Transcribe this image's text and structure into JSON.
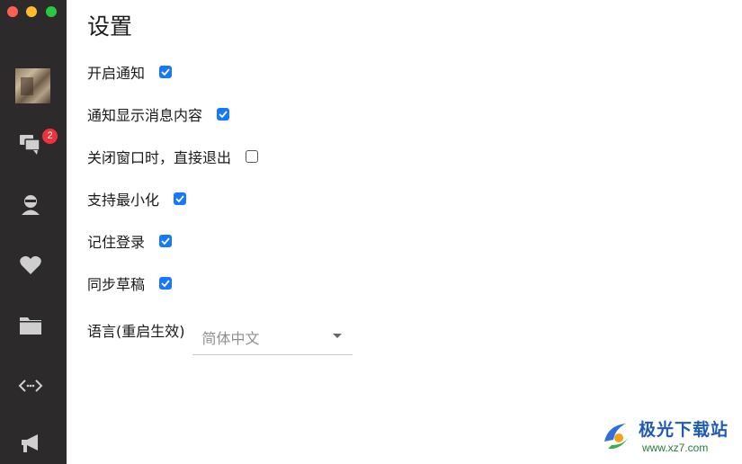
{
  "window": {
    "controls": [
      "close",
      "minimize",
      "zoom"
    ]
  },
  "sidebar": {
    "avatar": "user-avatar",
    "items": [
      {
        "icon": "chat-icon",
        "badge": "2"
      },
      {
        "icon": "contact-icon"
      },
      {
        "icon": "heart-icon"
      },
      {
        "icon": "folder-icon"
      },
      {
        "icon": "code-icon"
      },
      {
        "icon": "megaphone-icon"
      }
    ]
  },
  "settings": {
    "title": "设置",
    "options": [
      {
        "label": "开启通知",
        "checked": true
      },
      {
        "label": "通知显示消息内容",
        "checked": true
      },
      {
        "label": "关闭窗口时，直接退出",
        "checked": false
      },
      {
        "label": "支持最小化",
        "checked": true
      },
      {
        "label": "记住登录",
        "checked": true
      },
      {
        "label": "同步草稿",
        "checked": true
      }
    ],
    "language": {
      "label": "语言(重启生效)",
      "value": "简体中文"
    }
  },
  "watermark": {
    "text": "极光下载站",
    "url": "www.xz7.com"
  },
  "colors": {
    "sidebar": "#2c2a2b",
    "accent": "#1677ff",
    "badge": "#f0323c"
  }
}
